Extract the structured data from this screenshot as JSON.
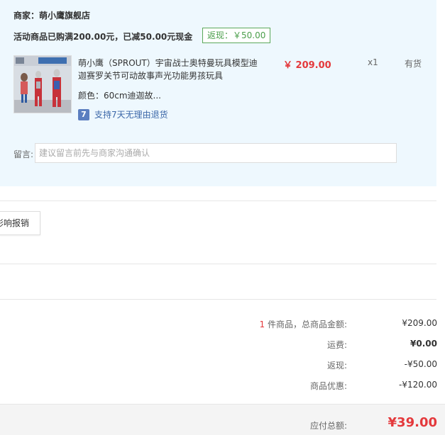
{
  "store": {
    "merchant_label": "商家：萌小鹰旗舰店",
    "promo_text": "活动商品已购满200.00元，已减50.00元现金",
    "rebate_badge": "返现：￥50.00"
  },
  "product": {
    "title": "萌小鹰（SPROUT）宇宙战士奥特曼玩具模型迪迦赛罗关节可动故事声光功能男孩玩具",
    "price": "￥ 209.00",
    "quantity": "x1",
    "stock": "有货",
    "spec": "颜色：60cm迪迦故...",
    "return_policy": "支持7天无理由退货",
    "return_icon_glyph": "7"
  },
  "message": {
    "label": "留言:",
    "placeholder": "建议留言前先与商家沟通确认"
  },
  "impact_button": "影响报销",
  "summary": {
    "count": "1",
    "count_label": " 件商品，总商品金额:",
    "subtotal": "¥209.00",
    "shipping_label": "运费:",
    "shipping": "¥0.00",
    "rebate_label": "返现:",
    "rebate": "-¥50.00",
    "discount_label": "商品优惠:",
    "discount": "-¥120.00",
    "total_label": "应付总额:",
    "total": "¥39.00"
  },
  "colors": {
    "panel_bg": "#eef8fe",
    "price_red": "#e4393c",
    "rebate_green": "#4a9e4a",
    "link_blue": "#3b67a8"
  }
}
